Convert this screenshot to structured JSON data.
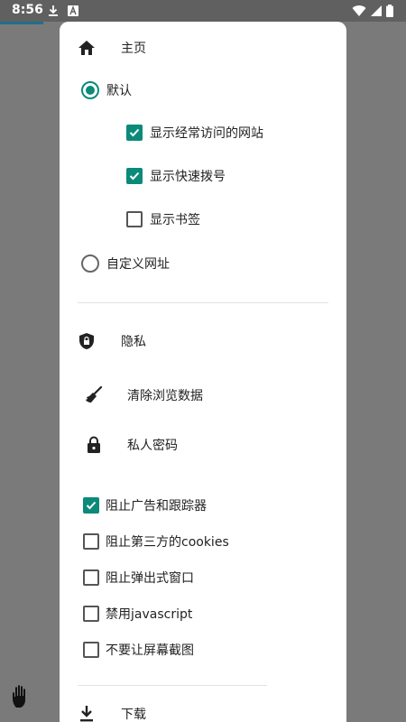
{
  "status_bar": {
    "time": "8:56",
    "icons": [
      "download-icon",
      "app-icon",
      "wifi-icon",
      "signal-icon",
      "battery-icon"
    ]
  },
  "menu": {
    "home": {
      "label": "主页",
      "icon": "home-icon"
    },
    "home_options": [
      {
        "label": "默认",
        "selected": true
      },
      {
        "label": "自定义网址",
        "selected": false
      }
    ],
    "default_sub_options": [
      {
        "label": "显示经常访问的网站",
        "checked": true
      },
      {
        "label": "显示快速拨号",
        "checked": true
      },
      {
        "label": "显示书签",
        "checked": false
      }
    ],
    "privacy": {
      "label": "隐私",
      "icon": "shield-lock-icon"
    },
    "privacy_actions": [
      {
        "label": "清除浏览数据",
        "icon": "broom-icon"
      },
      {
        "label": "私人密码",
        "icon": "lock-icon"
      }
    ],
    "privacy_toggles": [
      {
        "label": "阻止广告和跟踪器",
        "checked": true
      },
      {
        "label": "阻止第三方的cookies",
        "checked": false
      },
      {
        "label": "阻止弹出式窗口",
        "checked": false
      },
      {
        "label": "禁用javascript",
        "checked": false
      },
      {
        "label": "不要让屏幕截图",
        "checked": false
      }
    ],
    "downloads": {
      "label": "下载",
      "icon": "download-icon"
    }
  },
  "overlay": {
    "icon": "hand-icon"
  },
  "colors": {
    "accent": "#0b8a7a",
    "scrim": "#7a7a7a",
    "panel": "#ffffff"
  }
}
